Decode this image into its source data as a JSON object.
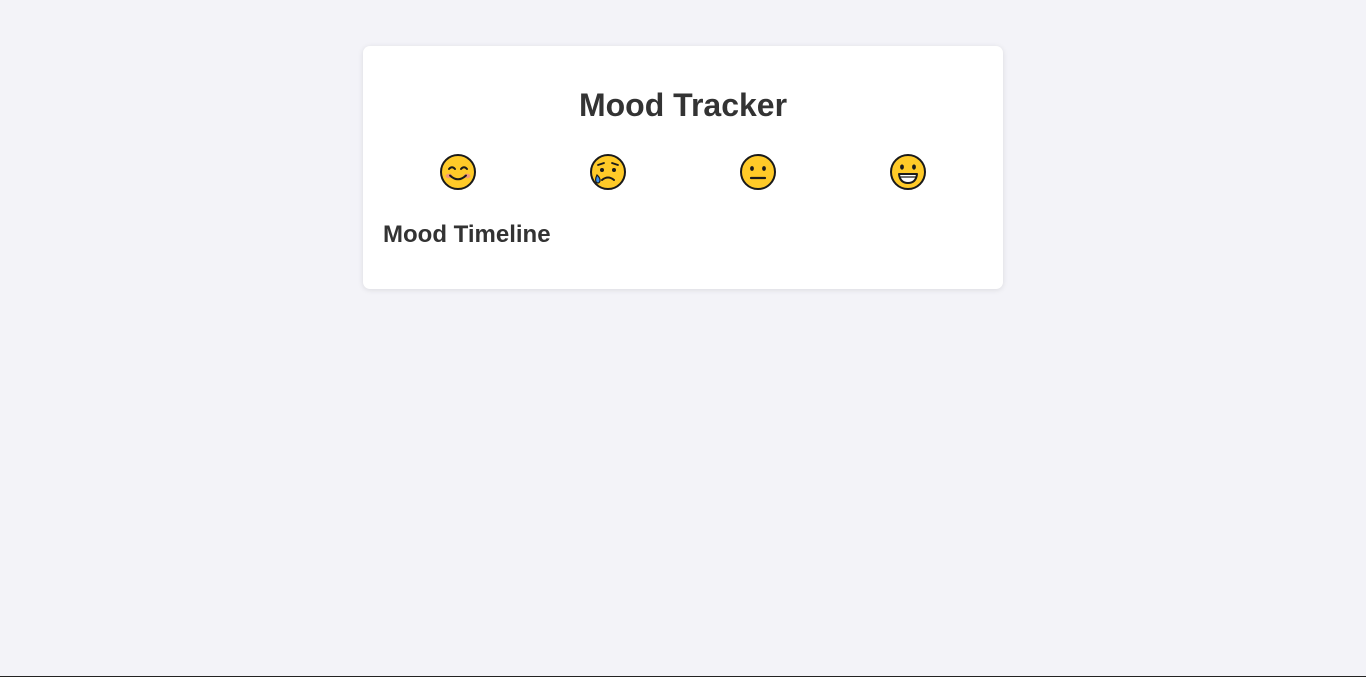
{
  "app": {
    "title": "Mood Tracker",
    "timeline_heading": "Mood Timeline"
  },
  "moods": [
    {
      "icon": "smiling-face-icon",
      "emoji": "😊"
    },
    {
      "icon": "crying-face-icon",
      "emoji": "😢"
    },
    {
      "icon": "neutral-face-icon",
      "emoji": "😐"
    },
    {
      "icon": "grinning-face-icon",
      "emoji": "😃"
    }
  ],
  "colors": {
    "background": "#f3f3f8",
    "card": "#ffffff",
    "text": "#333333",
    "emoji_face": "#ffca28",
    "emoji_outline": "#1a1a1a",
    "tear": "#3a8ee6",
    "blush": "#f08a8a"
  },
  "timeline": []
}
